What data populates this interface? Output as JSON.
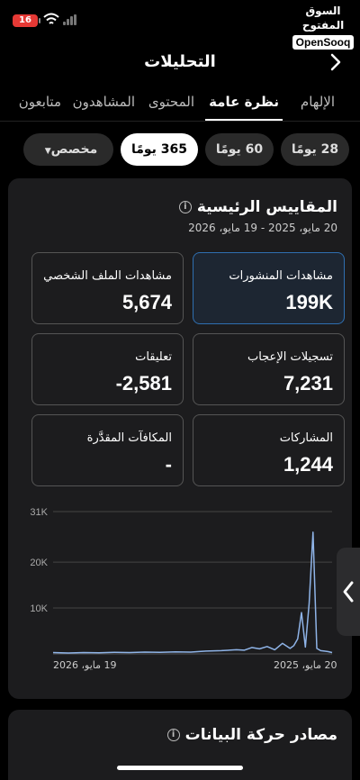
{
  "status": {
    "battery": "16"
  },
  "brand": {
    "arabic": "السوق المفتوح",
    "english": "OpenSooq"
  },
  "header": {
    "title": "التحليلات"
  },
  "tabs": [
    {
      "label": "الإلهام"
    },
    {
      "label": "نظرة عامة"
    },
    {
      "label": "المحتوى"
    },
    {
      "label": "المشاهدون"
    },
    {
      "label": "متابعون"
    }
  ],
  "ranges": [
    {
      "label": "28 يومًا"
    },
    {
      "label": "60 يومًا"
    },
    {
      "label": "365 يومًا"
    },
    {
      "label": "مخصص"
    }
  ],
  "overview": {
    "title": "المقاييس الرئيسية",
    "date_range": "20 مايو، 2025 - 19 مايو، 2026",
    "metrics": [
      {
        "label": "مشاهدات المنشورات",
        "value": "199K"
      },
      {
        "label": "مشاهدات الملف الشخصي",
        "value": "5,674"
      },
      {
        "label": "تسجيلات الإعجاب",
        "value": "7,231"
      },
      {
        "label": "تعليقات",
        "value": "-2,581"
      },
      {
        "label": "المشاركات",
        "value": "1,244"
      },
      {
        "label": "المكافآت المقدَّرة",
        "value": "-"
      }
    ]
  },
  "chart_data": {
    "type": "line",
    "y_ticks": [
      "31K",
      "20K",
      "10K"
    ],
    "ylim": [
      0,
      31000
    ],
    "x_labels": [
      "20 مايو، 2025",
      "19 مايو، 2026"
    ],
    "series": [
      {
        "color": "#8fb4e8",
        "x": [
          0,
          20,
          40,
          60,
          80,
          100,
          120,
          140,
          160,
          180,
          200,
          220,
          240,
          250,
          260,
          270,
          280,
          290,
          300,
          310,
          315,
          320,
          325,
          330,
          335,
          340,
          345,
          350,
          355,
          360,
          365
        ],
        "y": [
          300,
          200,
          300,
          250,
          350,
          300,
          400,
          350,
          450,
          400,
          600,
          700,
          900,
          800,
          1400,
          1100,
          1600,
          900,
          2300,
          1200,
          1800,
          3300,
          9000,
          1500,
          11000,
          26500,
          1200,
          700,
          600,
          500,
          300
        ]
      }
    ]
  },
  "sources": {
    "title": "مصادر حركة البيانات"
  }
}
